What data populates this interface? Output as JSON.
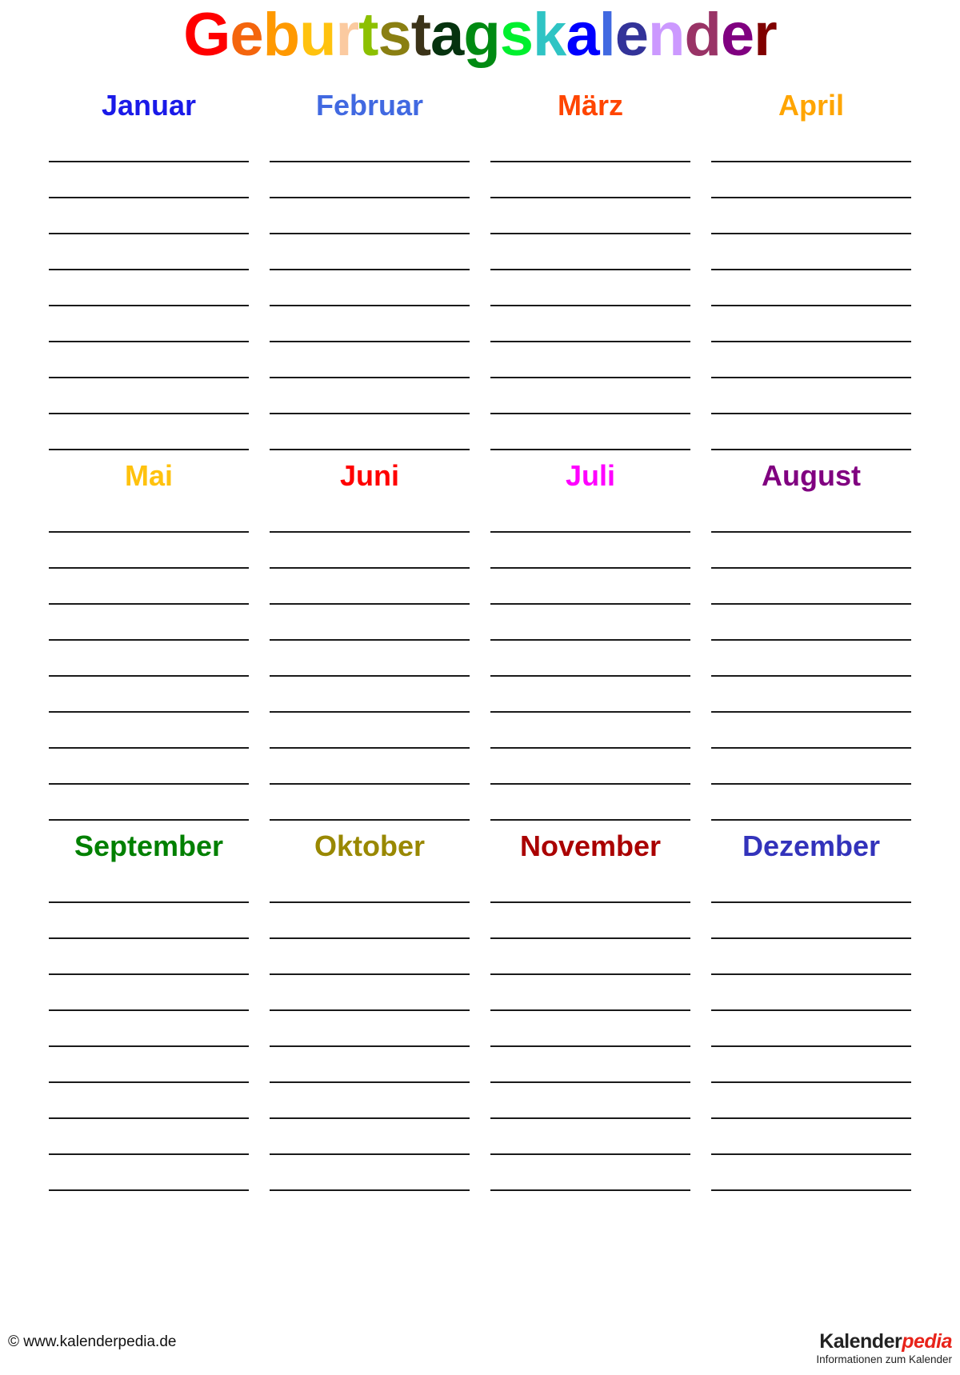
{
  "document": {
    "title_text": "Geburtstagskalender",
    "title_letters": [
      {
        "ch": "G",
        "color": "#ff0000"
      },
      {
        "ch": "e",
        "color": "#f4650d"
      },
      {
        "ch": "b",
        "color": "#ff9900"
      },
      {
        "ch": "u",
        "color": "#ffc20e"
      },
      {
        "ch": "r",
        "color": "#fbcaa0"
      },
      {
        "ch": "t",
        "color": "#8cc000"
      },
      {
        "ch": "s",
        "color": "#8a7f12"
      },
      {
        "ch": "t",
        "color": "#3b3318"
      },
      {
        "ch": "a",
        "color": "#06330f"
      },
      {
        "ch": "g",
        "color": "#008a12"
      },
      {
        "ch": "s",
        "color": "#00ef2e"
      },
      {
        "ch": "k",
        "color": "#2fc4c4"
      },
      {
        "ch": "a",
        "color": "#0000ff"
      },
      {
        "ch": "l",
        "color": "#4169e1"
      },
      {
        "ch": "e",
        "color": "#333399"
      },
      {
        "ch": "n",
        "color": "#cc99ff"
      },
      {
        "ch": "d",
        "color": "#993366"
      },
      {
        "ch": "e",
        "color": "#800080"
      },
      {
        "ch": "r",
        "color": "#800000"
      }
    ],
    "lines_per_month": 9
  },
  "months": [
    {
      "name": "Januar",
      "color": "#1a1ae8",
      "lines": [
        "",
        "",
        "",
        "",
        "",
        "",
        "",
        "",
        ""
      ]
    },
    {
      "name": "Februar",
      "color": "#4169e1",
      "lines": [
        "",
        "",
        "",
        "",
        "",
        "",
        "",
        "",
        ""
      ]
    },
    {
      "name": "März",
      "color": "#ff4500",
      "lines": [
        "",
        "",
        "",
        "",
        "",
        "",
        "",
        "",
        ""
      ]
    },
    {
      "name": "April",
      "color": "#ffa500",
      "lines": [
        "",
        "",
        "",
        "",
        "",
        "",
        "",
        "",
        ""
      ]
    },
    {
      "name": "Mai",
      "color": "#ffc20e",
      "lines": [
        "",
        "",
        "",
        "",
        "",
        "",
        "",
        "",
        ""
      ]
    },
    {
      "name": "Juni",
      "color": "#ff0000",
      "lines": [
        "",
        "",
        "",
        "",
        "",
        "",
        "",
        "",
        ""
      ]
    },
    {
      "name": "Juli",
      "color": "#ff00ff",
      "lines": [
        "",
        "",
        "",
        "",
        "",
        "",
        "",
        "",
        ""
      ]
    },
    {
      "name": "August",
      "color": "#800080",
      "lines": [
        "",
        "",
        "",
        "",
        "",
        "",
        "",
        "",
        ""
      ]
    },
    {
      "name": "September",
      "color": "#008000",
      "lines": [
        "",
        "",
        "",
        "",
        "",
        "",
        "",
        "",
        ""
      ]
    },
    {
      "name": "Oktober",
      "color": "#998800",
      "lines": [
        "",
        "",
        "",
        "",
        "",
        "",
        "",
        "",
        ""
      ]
    },
    {
      "name": "November",
      "color": "#aa0000",
      "lines": [
        "",
        "",
        "",
        "",
        "",
        "",
        "",
        "",
        ""
      ]
    },
    {
      "name": "Dezember",
      "color": "#3333bb",
      "lines": [
        "",
        "",
        "",
        "",
        "",
        "",
        "",
        "",
        ""
      ]
    }
  ],
  "footer": {
    "copyright": "© www.kalenderpedia.de",
    "brand_primary": "Kalender",
    "brand_accent": "pedia",
    "brand_subtitle": "Informationen zum Kalender",
    "accent_color": "#e8231a"
  }
}
